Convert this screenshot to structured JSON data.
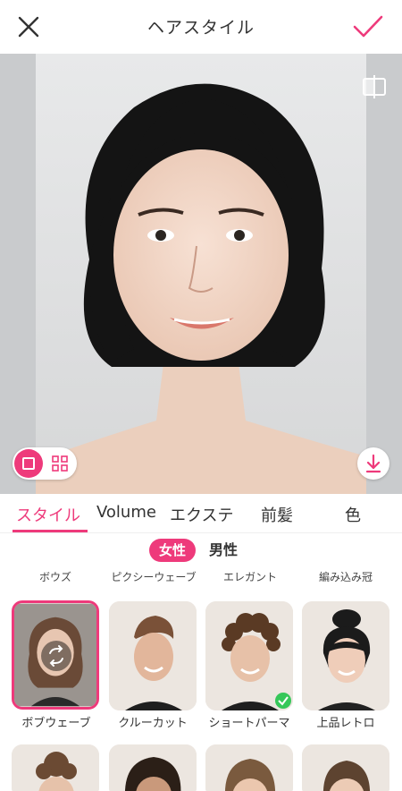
{
  "header": {
    "title": "ヘアスタイル"
  },
  "tabs": [
    {
      "label": "スタイル",
      "active": true
    },
    {
      "label": "Volume",
      "active": false
    },
    {
      "label": "エクステ",
      "active": false
    },
    {
      "label": "前髪",
      "active": false
    },
    {
      "label": "色",
      "active": false
    }
  ],
  "gender": {
    "female": "女性",
    "male": "男性"
  },
  "categories": [
    "ボウズ",
    "ピクシーウェーブ",
    "エレガント",
    "編み込み冠"
  ],
  "styles": [
    {
      "label": "ボブウェーブ",
      "selected": true
    },
    {
      "label": "クルーカット",
      "selected": false
    },
    {
      "label": "ショートパーマ",
      "selected": false,
      "applied": true
    },
    {
      "label": "上品レトロ",
      "selected": false
    }
  ],
  "colors": {
    "accent": "#ee3a7b",
    "check": "#35c759"
  },
  "icons": {
    "close": "close-icon",
    "confirm": "checkmark-icon",
    "compare": "compare-icon",
    "single_view": "single-view-icon",
    "grid_view": "grid-view-icon",
    "download": "download-icon",
    "swap": "swap-icon",
    "applied": "check-badge-icon"
  }
}
